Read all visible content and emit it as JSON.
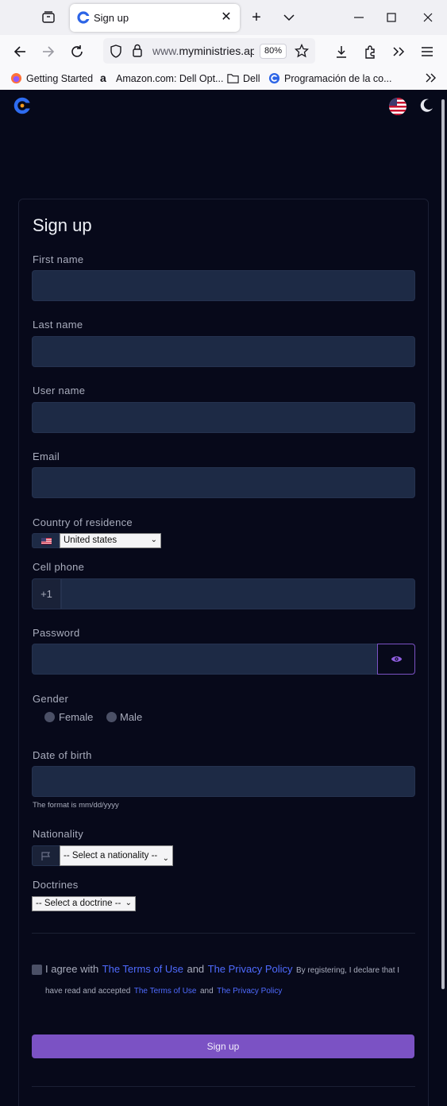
{
  "browser": {
    "tab_title": "Sign up",
    "url_prefix": "www.",
    "url_domain": "myministries.ap",
    "zoom": "80%",
    "bookmarks": [
      {
        "label": "Getting Started"
      },
      {
        "label": "Amazon.com: Dell Opt..."
      },
      {
        "label": "Dell"
      },
      {
        "label": "Programación de la co..."
      }
    ]
  },
  "form": {
    "title": "Sign up",
    "first_name_label": "First name",
    "last_name_label": "Last name",
    "user_name_label": "User name",
    "email_label": "Email",
    "country_label": "Country of residence",
    "country_value": "United states",
    "cell_phone_label": "Cell phone",
    "phone_prefix": "+1",
    "password_label": "Password",
    "gender_label": "Gender",
    "gender_female": "Female",
    "gender_male": "Male",
    "dob_label": "Date of birth",
    "dob_help": "The format is mm/dd/yyyy",
    "nationality_label": "Nationality",
    "nationality_value": "-- Select a nationality --",
    "doctrines_label": "Doctrines",
    "doctrines_value": "-- Select a doctrine --",
    "agree_text": "I agree with",
    "terms_link": "The Terms of Use",
    "and_text": "and",
    "privacy_link": "The Privacy Policy",
    "declare_text": "By registering, I declare that I have read and accepted",
    "submit_label": "Sign up"
  },
  "colors": {
    "page_bg": "#06091a",
    "input_bg": "#1d2a45",
    "accent": "#7b52c4",
    "link": "#4f6bff"
  }
}
